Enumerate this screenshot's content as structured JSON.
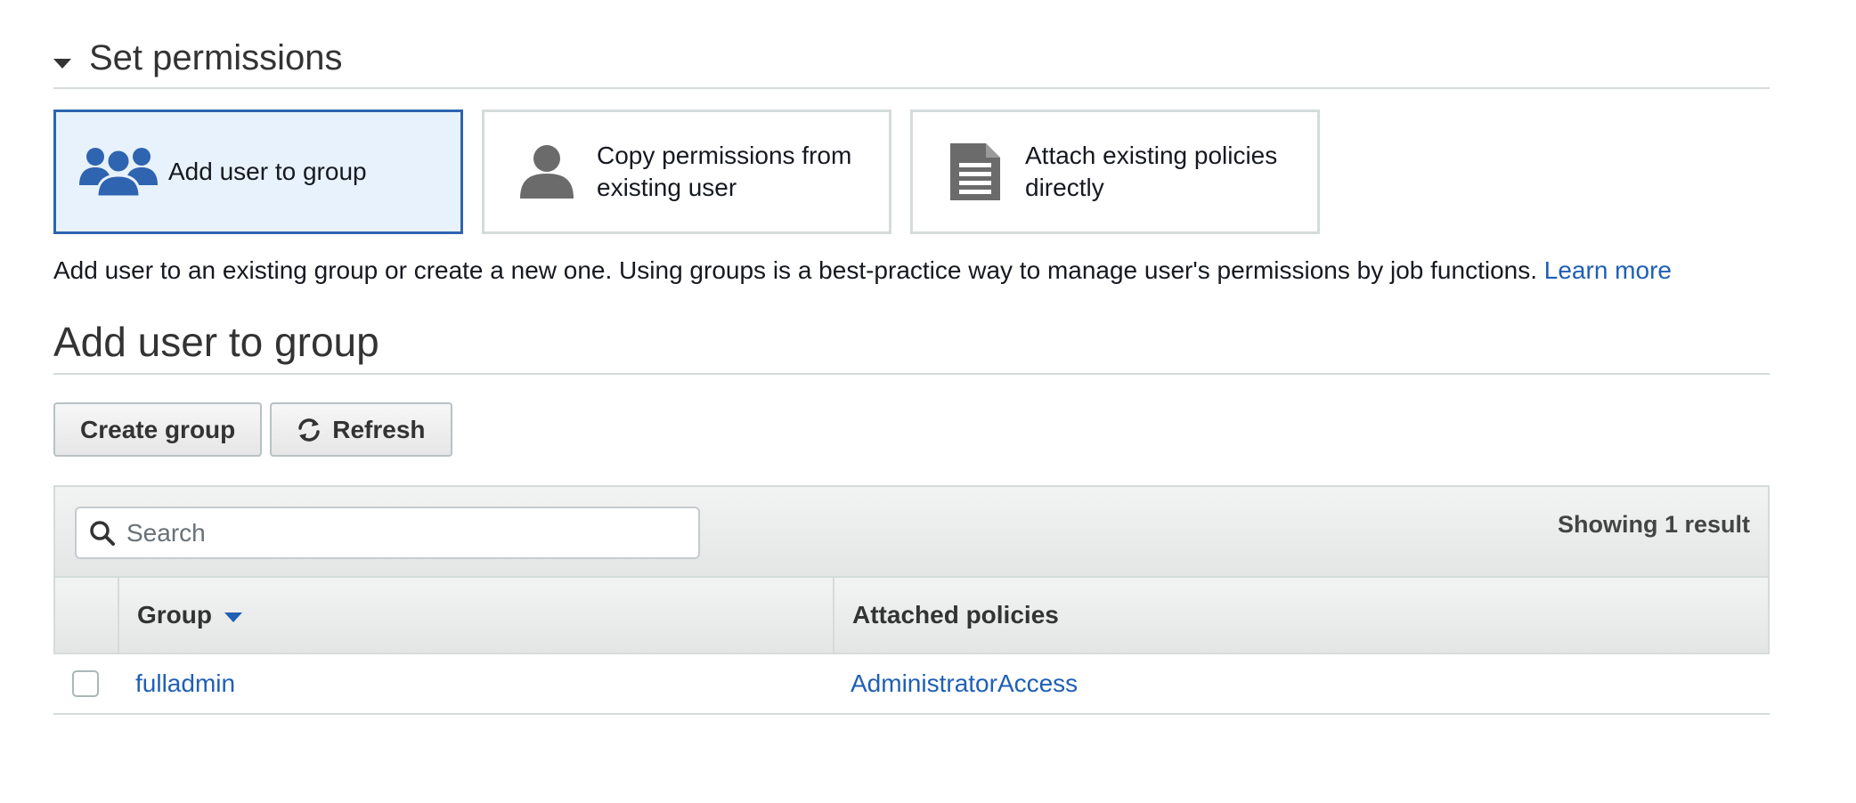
{
  "set_permissions": {
    "title": "Set permissions",
    "options": [
      {
        "label": "Add user to group",
        "icon": "group-icon",
        "selected": true
      },
      {
        "label": "Copy permissions from existing user",
        "icon": "user-icon",
        "selected": false
      },
      {
        "label": "Attach existing policies directly",
        "icon": "document-icon",
        "selected": false
      }
    ],
    "description": "Add user to an existing group or create a new one. Using groups is a best-practice way to manage user's permissions by job functions.",
    "learn_more": "Learn more"
  },
  "add_user_to_group": {
    "title": "Add user to group",
    "create_group_label": "Create group",
    "refresh_label": "Refresh"
  },
  "table": {
    "search_placeholder": "Search",
    "result_count": "Showing 1 result",
    "columns": {
      "group": "Group",
      "policies": "Attached policies"
    },
    "rows": [
      {
        "group": "fulladmin",
        "policies": "AdministratorAccess",
        "checked": false
      }
    ]
  },
  "colors": {
    "accent": "#2e64b0",
    "link": "#1f5fb5",
    "selected_bg": "#e8f2fc",
    "icon_gray": "#6b6b6b"
  }
}
